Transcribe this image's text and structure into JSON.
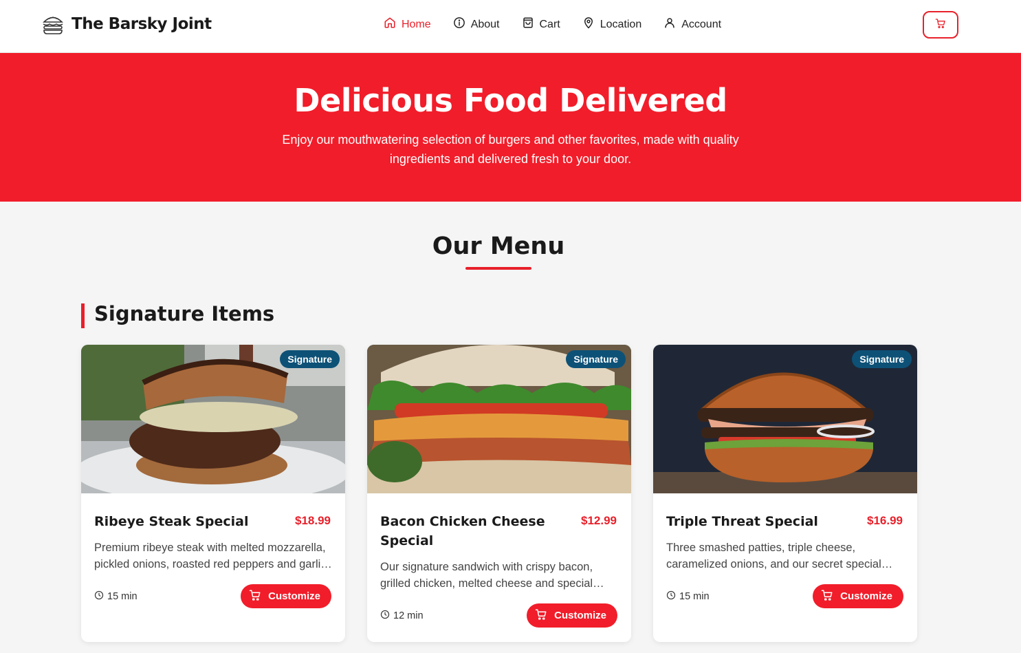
{
  "brand": {
    "name": "The Barsky Joint",
    "logo_icon": "burger-icon"
  },
  "nav": {
    "items": [
      {
        "label": "Home",
        "icon": "home-icon",
        "active": true
      },
      {
        "label": "About",
        "icon": "info-icon",
        "active": false
      },
      {
        "label": "Cart",
        "icon": "shopping-bag-icon",
        "active": false
      },
      {
        "label": "Location",
        "icon": "map-pin-icon",
        "active": false
      },
      {
        "label": "Account",
        "icon": "user-icon",
        "active": false
      }
    ],
    "cart_button_icon": "cart-icon"
  },
  "hero": {
    "title": "Delicious Food Delivered",
    "subtitle": "Enjoy our mouthwatering selection of burgers and other favorites, made with quality ingredients and delivered fresh to your door."
  },
  "menu": {
    "title": "Our Menu",
    "section_title": "Signature Items",
    "items": [
      {
        "badge": "Signature",
        "name": "Ribeye Steak Special",
        "price": "$18.99",
        "description": "Premium ribeye steak with melted mozzarella, pickled onions, roasted red peppers and garlic aioli on toasted bread.",
        "time": "15 min",
        "button_label": "Customize"
      },
      {
        "badge": "Signature",
        "name": "Bacon Chicken Cheese Special",
        "price": "$12.99",
        "description": "Our signature sandwich with crispy bacon, grilled chicken, melted cheese and special sauce on a toasted bun.",
        "time": "12 min",
        "button_label": "Customize"
      },
      {
        "badge": "Signature",
        "name": "Triple Threat Special",
        "price": "$16.99",
        "description": "Three smashed patties, triple cheese, caramelized onions, and our secret special sauce on a brioche bun.",
        "time": "15 min",
        "button_label": "Customize"
      }
    ]
  },
  "colors": {
    "accent": "#e8202a",
    "hero": "#f11d2a",
    "badge": "#0d5177",
    "background": "#f5f5f5"
  }
}
